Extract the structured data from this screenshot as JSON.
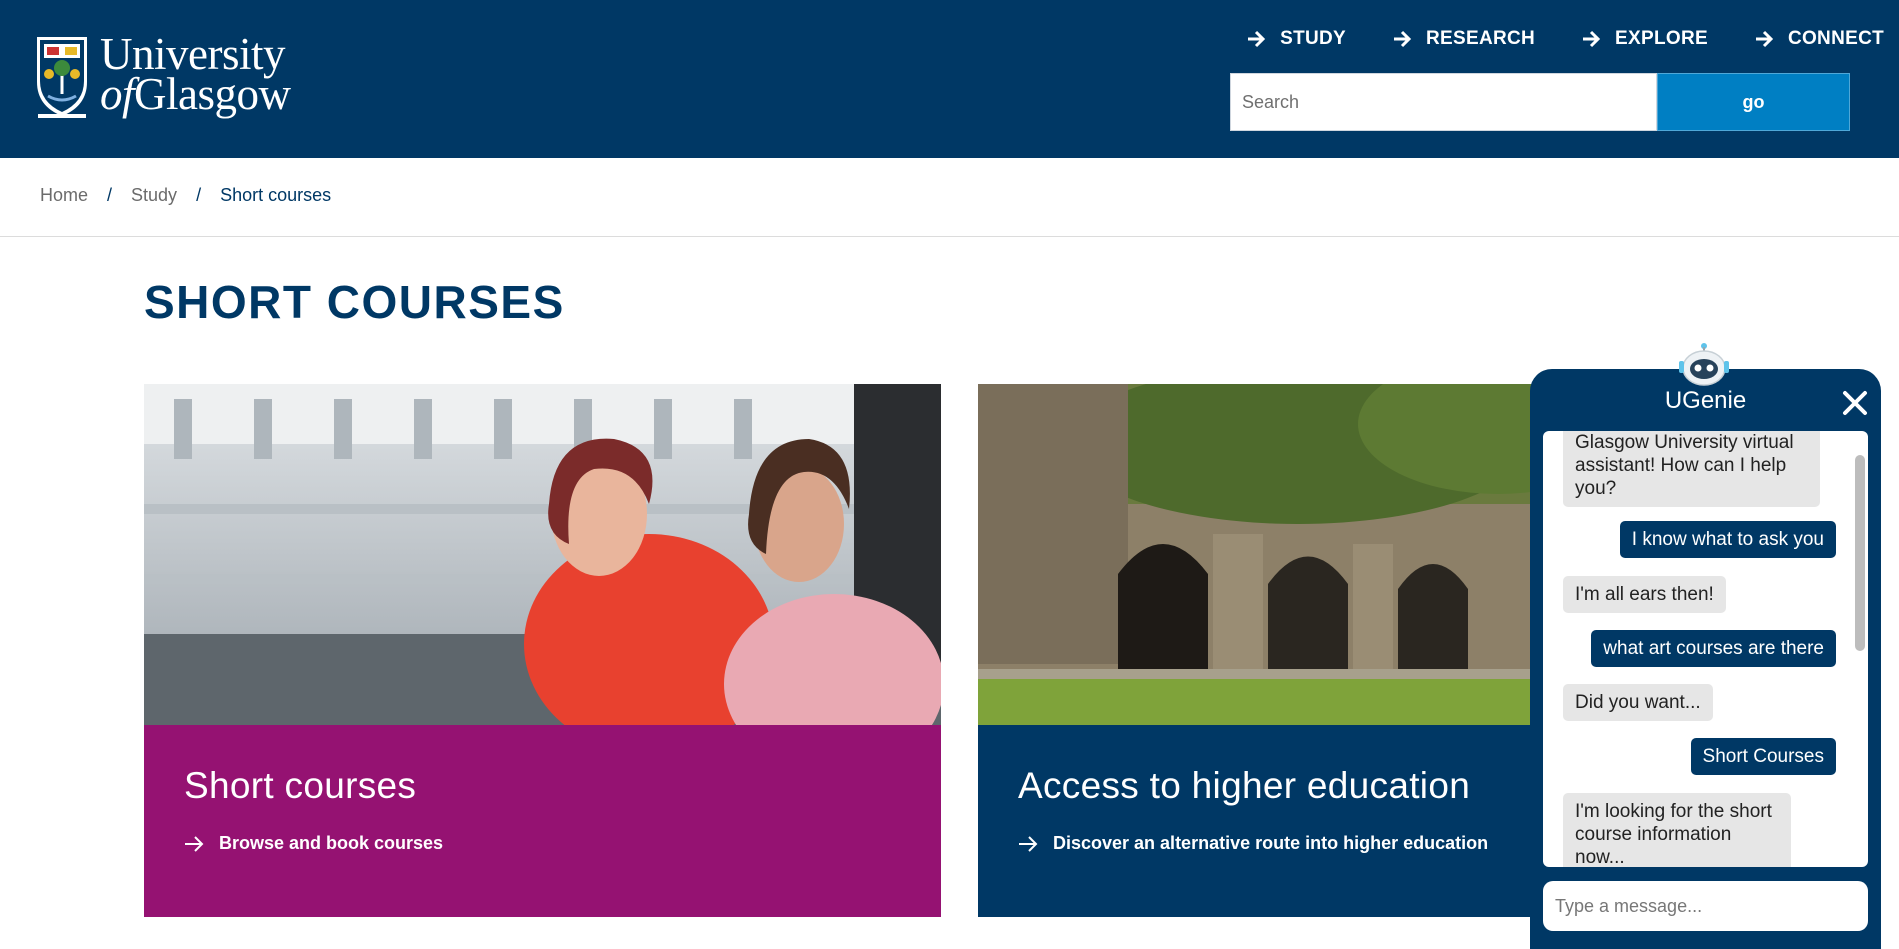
{
  "header": {
    "logo": {
      "line1": "University",
      "line2_of": "of",
      "line2_name": "Glasgow"
    },
    "nav": [
      {
        "label": "STUDY"
      },
      {
        "label": "RESEARCH"
      },
      {
        "label": "EXPLORE"
      },
      {
        "label": "CONNECT"
      }
    ],
    "search": {
      "placeholder": "Search",
      "button_label": "go"
    }
  },
  "breadcrumb": [
    {
      "label": "Home"
    },
    {
      "label": "Study"
    },
    {
      "label": "Short courses"
    }
  ],
  "breadcrumb_separator": "/",
  "page_title": "SHORT COURSES",
  "cards": [
    {
      "title": "Short courses",
      "link": "Browse and book courses",
      "color": "#951272"
    },
    {
      "title": "Access to higher education",
      "link": "Discover an alternative route into higher education",
      "color": "#003865"
    }
  ],
  "chat": {
    "title": "UGenie",
    "input_placeholder": "Type a message...",
    "messages": [
      {
        "from": "bot",
        "text": "Glasgow University virtual assistant! How can I help you?"
      },
      {
        "from": "user",
        "text": "I know what to ask you"
      },
      {
        "from": "bot",
        "text": "I'm all ears then!"
      },
      {
        "from": "user",
        "text": "what art courses are there"
      },
      {
        "from": "bot",
        "text": "Did you want..."
      },
      {
        "from": "user",
        "text": "Short Courses"
      },
      {
        "from": "bot",
        "text": "I'm looking for the short course information now..."
      }
    ]
  },
  "colors": {
    "brand": "#003865",
    "accent": "#007fc3",
    "card_purple": "#951272"
  }
}
